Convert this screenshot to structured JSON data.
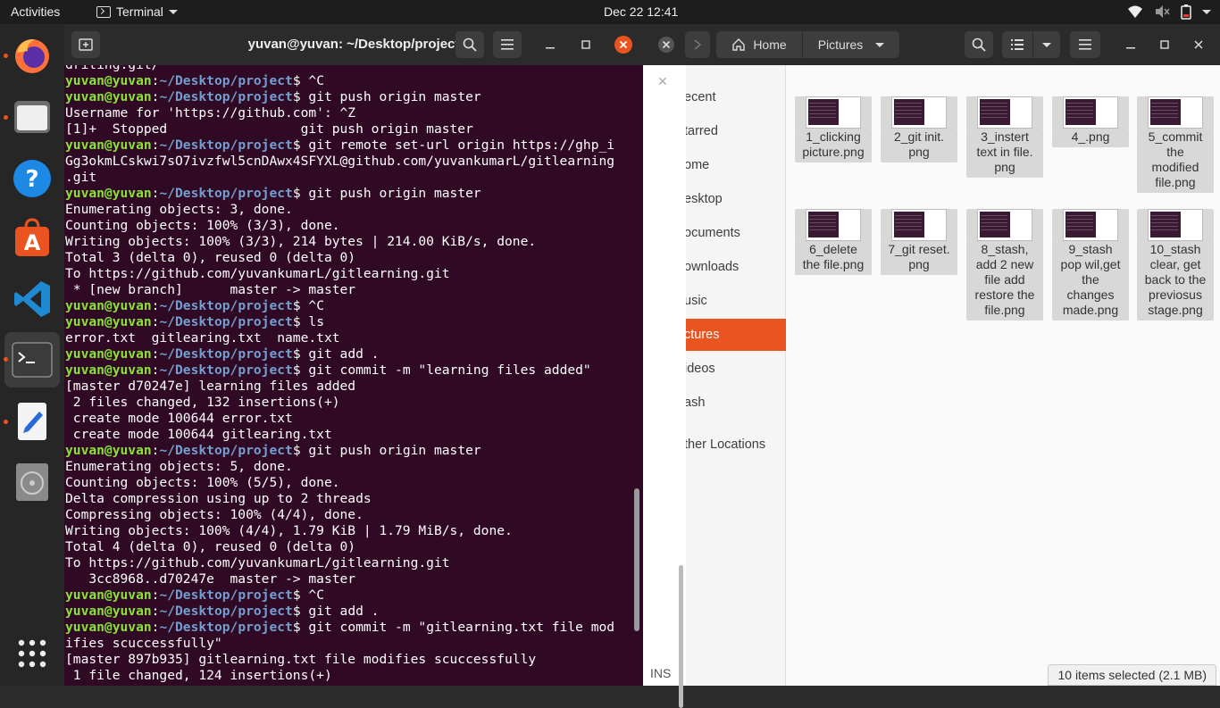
{
  "topbar": {
    "activities": "Activities",
    "app_name": "Terminal",
    "clock": "Dec 22  12:41"
  },
  "terminal": {
    "title": "yuvan@yuvan: ~/Desktop/project",
    "prompt_user": "yuvan@yuvan",
    "prompt_path": "~/Desktop/project",
    "lines": [
      {
        "out": "driting.git/"
      },
      {
        "cmd": " ^C"
      },
      {
        "cmd": " git push origin master"
      },
      {
        "out": "Username for 'https://github.com': ^Z"
      },
      {
        "out": "[1]+  Stopped                 git push origin master"
      },
      {
        "cmd": " git remote set-url origin https://ghp_i"
      },
      {
        "out": "Gg3okmLCskwi7sO7ivzfwl5cnDAwx4SFYXL@github.com/yuvankumarL/gitlearning"
      },
      {
        "out": ".git"
      },
      {
        "cmd": " git push origin master"
      },
      {
        "out": "Enumerating objects: 3, done."
      },
      {
        "out": "Counting objects: 100% (3/3), done."
      },
      {
        "out": "Writing objects: 100% (3/3), 214 bytes | 214.00 KiB/s, done."
      },
      {
        "out": "Total 3 (delta 0), reused 0 (delta 0)"
      },
      {
        "out": "To https://github.com/yuvankumarL/gitlearning.git"
      },
      {
        "out": " * [new branch]      master -> master"
      },
      {
        "cmd": " ^C"
      },
      {
        "cmd": " ls"
      },
      {
        "out": "error.txt  gitlearing.txt  name.txt"
      },
      {
        "cmd": " git add ."
      },
      {
        "cmd": " git commit -m \"learning files added\""
      },
      {
        "out": "[master d70247e] learning files added"
      },
      {
        "out": " 2 files changed, 132 insertions(+)"
      },
      {
        "out": " create mode 100644 error.txt"
      },
      {
        "out": " create mode 100644 gitlearing.txt"
      },
      {
        "cmd": " git push origin master"
      },
      {
        "out": "Enumerating objects: 5, done."
      },
      {
        "out": "Counting objects: 100% (5/5), done."
      },
      {
        "out": "Delta compression using up to 2 threads"
      },
      {
        "out": "Compressing objects: 100% (4/4), done."
      },
      {
        "out": "Writing objects: 100% (4/4), 1.79 KiB | 1.79 MiB/s, done."
      },
      {
        "out": "Total 4 (delta 0), reused 0 (delta 0)"
      },
      {
        "out": "To https://github.com/yuvankumarL/gitlearning.git"
      },
      {
        "out": "   3cc8968..d70247e  master -> master"
      },
      {
        "cmd": " ^C"
      },
      {
        "cmd": " git add ."
      },
      {
        "cmd": " git commit -m \"gitlearning.txt file mod"
      },
      {
        "out": "ifies scuccessfully\""
      },
      {
        "out": "[master 897b935] gitlearning.txt file modifies scuccessfully"
      },
      {
        "out": " 1 file changed, 124 insertions(+)"
      }
    ]
  },
  "files": {
    "path_home": "Home",
    "path_current": "Pictures",
    "sidebar": [
      "ecent",
      "tarred",
      "ome",
      "esktop",
      "ocuments",
      "ownloads",
      "usic",
      "ctures",
      "ideos",
      "ash",
      "ther Locations"
    ],
    "items": [
      "1_clicking\npicture.png",
      "2_git init.\npng",
      "3_instert\ntext in file.\npng",
      "4_.png",
      "5_commit\nthe\nmodified\nfile.png",
      "6_delete\nthe file.png",
      "7_git reset.\npng",
      "8_stash,\nadd 2 new\nfile add\nrestore the\nfile.png",
      "9_stash\npop wil,get\nthe\nchanges\nmade.png",
      "10_stash\nclear, get\nback to the\npreviosus\nstage.png"
    ],
    "status": "10 items selected  (2.1 MB)",
    "ins": "INS"
  },
  "colors": {
    "terminal_bg": "#300a24",
    "prompt_user": "#8ae234",
    "prompt_path": "#729fcf",
    "accent": "#e95420"
  }
}
